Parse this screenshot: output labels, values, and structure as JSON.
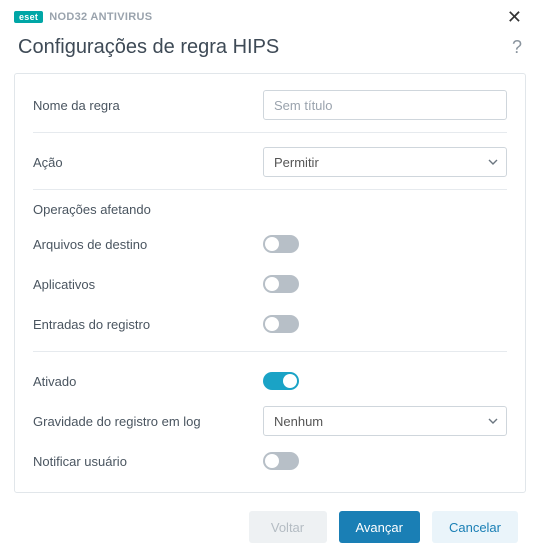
{
  "brand": {
    "badge": "eset",
    "product": "NOD32 ANTIVIRUS"
  },
  "page_title": "Configurações de regra HIPS",
  "fields": {
    "rule_name": {
      "label": "Nome da regra",
      "placeholder": "Sem título"
    },
    "action": {
      "label": "Ação",
      "value": "Permitir"
    },
    "operations_section": "Operações afetando",
    "target_files": {
      "label": "Arquivos de destino",
      "on": false
    },
    "apps": {
      "label": "Aplicativos",
      "on": false
    },
    "registry_entries": {
      "label": "Entradas do registro",
      "on": false
    },
    "enabled": {
      "label": "Ativado",
      "on": true
    },
    "log_severity": {
      "label": "Gravidade do registro em log",
      "value": "Nenhum"
    },
    "notify_user": {
      "label": "Notificar usuário",
      "on": false
    }
  },
  "buttons": {
    "back": "Voltar",
    "next": "Avançar",
    "cancel": "Cancelar"
  }
}
